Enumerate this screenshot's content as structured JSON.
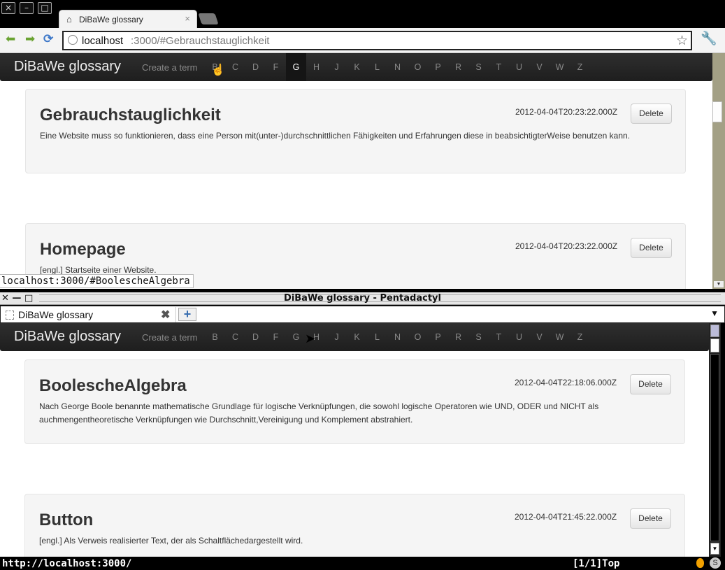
{
  "chrome": {
    "wm_buttons": [
      "×",
      "–",
      "□"
    ],
    "tab_title": "DiBaWe glossary",
    "tab_close": "×",
    "url_host": "localhost",
    "url_rest": ":3000/#Gebrauchstauglichkeit",
    "status_url": "localhost:3000/#BoolescheAlgebra",
    "icons": [
      "back-arrow-icon",
      "forward-arrow-icon",
      "reload-icon",
      "globe-icon",
      "star-icon",
      "wrench-icon",
      "home-icon"
    ],
    "app": {
      "brand": "DiBaWe glossary",
      "create": "Create a term",
      "letters": [
        "B",
        "C",
        "D",
        "F",
        "G",
        "H",
        "J",
        "K",
        "L",
        "N",
        "O",
        "P",
        "R",
        "S",
        "T",
        "U",
        "V",
        "W",
        "Z"
      ],
      "active_letter": "G",
      "entries": [
        {
          "title": "Gebrauchstauglichkeit",
          "date": "2012-04-04T20:23:22.000Z",
          "delete": "Delete",
          "desc": "Eine Website muss so funktionieren, dass eine Person mit(unter-)durchschnittlichen Fähigkeiten und Erfahrungen diese in beabsichtigterWeise benutzen kann."
        },
        {
          "title": "Homepage",
          "date": "2012-04-04T20:23:22.000Z",
          "delete": "Delete",
          "desc": "[engl.] Startseite einer Website."
        }
      ]
    }
  },
  "pentadactyl": {
    "window_title": "DiBaWe glossary - Pentadactyl",
    "wm_controls": "✕ — □",
    "tab_title": "DiBaWe glossary",
    "new_tab": "+",
    "tab_list": "▼",
    "app": {
      "brand": "DiBaWe glossary",
      "create": "Create a term",
      "letters": [
        "B",
        "C",
        "D",
        "F",
        "G",
        "H",
        "J",
        "K",
        "L",
        "N",
        "O",
        "P",
        "R",
        "S",
        "T",
        "U",
        "V",
        "W",
        "Z"
      ],
      "entries": [
        {
          "title": "BoolescheAlgebra",
          "date": "2012-04-04T22:18:06.000Z",
          "delete": "Delete",
          "desc": "Nach George Boole benannte mathematische Grundlage für logische Verknüpfungen, die sowohl logische Operatoren wie UND, ODER und NICHT als auchmengentheoretische Verknüpfungen wie Durchschnitt,Vereinigung und Komplement abstrahiert."
        },
        {
          "title": "Button",
          "date": "2012-04-04T21:45:22.000Z",
          "delete": "Delete",
          "desc": "[engl.] Als Verweis realisierter Text, der als Schaltflächedargestellt wird."
        }
      ]
    },
    "status_url": "http://localhost:3000/",
    "status_pos": "[1/1]Top"
  }
}
